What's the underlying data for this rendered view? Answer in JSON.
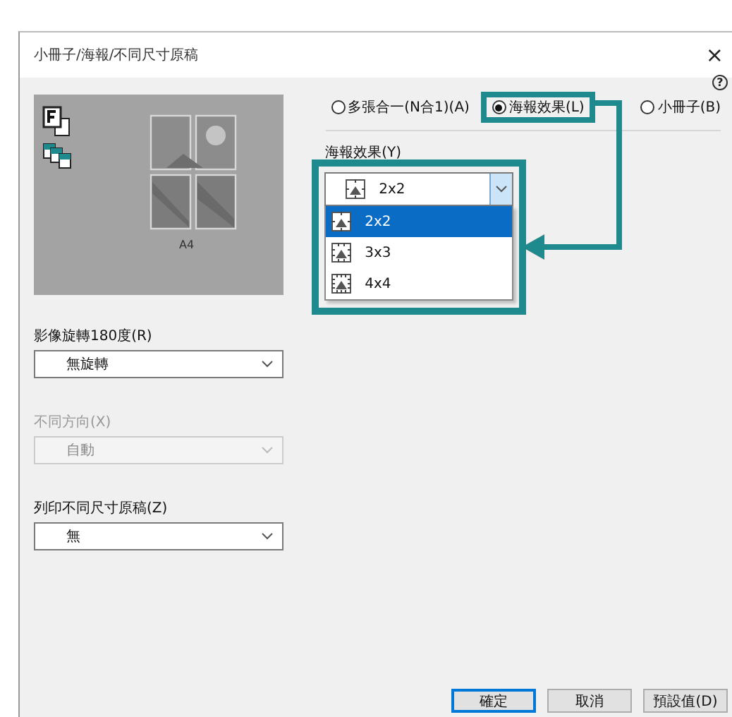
{
  "window": {
    "title": "小冊子/海報/不同尺寸原稿",
    "close": "×",
    "help": "?"
  },
  "preview": {
    "paper": "A4"
  },
  "layout_options": [
    {
      "label": "多張合一(N合1)(A)",
      "selected": false,
      "highlighted": false
    },
    {
      "label": "海報效果(L)",
      "selected": true,
      "highlighted": true
    },
    {
      "label": "小冊子(B)",
      "selected": false,
      "highlighted": false
    }
  ],
  "poster": {
    "label": "海報效果(Y)",
    "value": "2x2",
    "open": true,
    "options": [
      {
        "label": "2x2",
        "selected": true
      },
      {
        "label": "3x3",
        "selected": false
      },
      {
        "label": "4x4",
        "selected": false
      }
    ]
  },
  "settings": [
    {
      "label": "影像旋轉180度(R)",
      "value": "無旋轉",
      "disabled": false
    },
    {
      "label": "不同方向(X)",
      "value": "自動",
      "disabled": true
    },
    {
      "label": "列印不同尺寸原稿(Z)",
      "value": "無",
      "disabled": false
    }
  ],
  "buttons": [
    {
      "label": "確定",
      "kind": "default"
    },
    {
      "label": "取消",
      "kind": "normal"
    },
    {
      "label": "預設值(D)",
      "kind": "normal"
    }
  ]
}
